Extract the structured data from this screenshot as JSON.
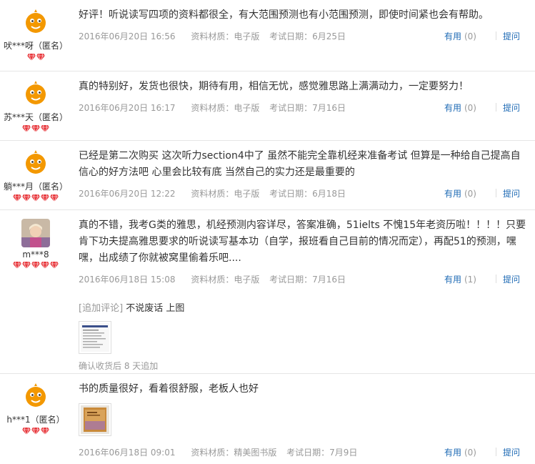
{
  "reviews": [
    {
      "user": "吠***呀（匿名）",
      "text": "好评！听说读写四项的资料都很全，有大范围预测也有小范围预测，即使时间紧也会有帮助。",
      "date": "2016年06月20日 16:56",
      "material": "资料材质：电子版",
      "exam_date": "考试日期：6月25日",
      "useful_label": "有用",
      "useful_count": "(0)",
      "ask_label": "提问"
    },
    {
      "user": "苏***天（匿名）",
      "text": "真的特别好，发货也很快，期待有用，相信无忧，感觉雅思路上满满动力，一定要努力！",
      "date": "2016年06月20日 16:17",
      "material": "资料材质：电子版",
      "exam_date": "考试日期：7月16日",
      "useful_label": "有用",
      "useful_count": "(0)",
      "ask_label": "提问"
    },
    {
      "user": "躺***月（匿名）",
      "text": "已经是第二次购买 这次听力section4中了 虽然不能完全靠机经来准备考试 但算是一种给自己提高自信心的好方法吧 心里会比较有底 当然自己的实力还是最重要的",
      "date": "2016年06月20日 12:22",
      "material": "资料材质：电子版",
      "exam_date": "考试日期：6月18日",
      "useful_label": "有用",
      "useful_count": "(0)",
      "ask_label": "提问"
    },
    {
      "user": "m***8",
      "text": "真的不错，我考G类的雅思，机经预测内容详尽，答案准确，51ielts 不愧15年老资历啦！！！！只要肯下功夫提高雅思要求的听说读写基本功（自学，报班看自己目前的情况而定），再配51的预测，嘿嘿，出成绩了你就被窝里偷着乐吧....",
      "date": "2016年06月18日 15:08",
      "material": "资料材质：电子版",
      "exam_date": "考试日期：7月16日",
      "useful_label": "有用",
      "useful_count": "(1)",
      "ask_label": "提问",
      "addon_tag": "[追加评论]",
      "addon_text": "不说废话 上图",
      "addon_foot": "确认收货后 8 天追加"
    },
    {
      "user": "h***1（匿名）",
      "text": "书的质量很好，看着很舒服，老板人也好",
      "date": "2016年06月18日 09:01",
      "material": "资料材质：精美图书版",
      "exam_date": "考试日期：7月9日",
      "useful_label": "有用",
      "useful_count": "(0)",
      "ask_label": "提问"
    }
  ],
  "colors": {
    "link": "#1f6bb5",
    "muted": "#999999",
    "gem": "#e8383d",
    "avatar_bg": "#f39800"
  }
}
